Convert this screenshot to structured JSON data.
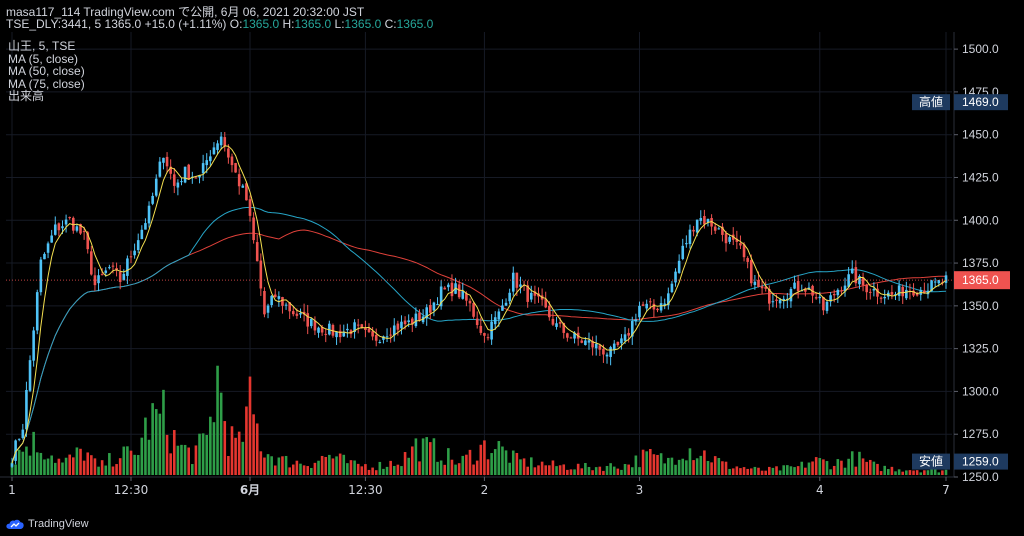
{
  "header": {
    "line1": "masa117_114 TradingView.com で公開, 6月 06, 2021 20:32:00 JST",
    "symbol": "TSE_DLY:3441, 5",
    "close": "1365.0",
    "change": "+15.0 (+1.11%)",
    "o_label": "O:",
    "o": "1365.0",
    "h_label": "H:",
    "h": "1365.0",
    "l_label": "L:",
    "l": "1365.0",
    "c_label": "C:",
    "c": "1365.0"
  },
  "legend": {
    "symbol": "山王, 5, TSE",
    "ma5": "MA (5, close)",
    "ma50": "MA (50, close)",
    "ma75": "MA (75, close)",
    "volume": "出来高"
  },
  "footer": {
    "brand": "TradingView"
  },
  "colors": {
    "up": "#26a69a",
    "up_candle": "#4fc3f7",
    "down": "#ef5350",
    "ma5": "#f5e050",
    "ma50": "#26a4c6",
    "ma75": "#e0413a",
    "vol_up": "#2e9e48",
    "vol_down": "#e5362f",
    "label_bg": "#1e3a5f",
    "price_tag": "#ef5350"
  },
  "chart_data": {
    "type": "candlestick",
    "ylim": [
      1250,
      1510
    ],
    "y_ticks": [
      "1500.0",
      "1475.0",
      "1450.0",
      "1425.0",
      "1400.0",
      "1375.0",
      "1350.0",
      "1325.0",
      "1300.0",
      "1275.0",
      "1250.0"
    ],
    "x_ticks": [
      {
        "label": "1",
        "bar": 0
      },
      {
        "label": "12:30",
        "bar": 33
      },
      {
        "label": "6月",
        "bar": 66
      },
      {
        "label": "12:30",
        "bar": 98
      },
      {
        "label": "2",
        "bar": 131
      },
      {
        "label": "3",
        "bar": 174
      },
      {
        "label": "4",
        "bar": 224
      },
      {
        "label": "7",
        "bar": 259
      }
    ],
    "high_label": "高値",
    "high_value": "1469.0",
    "high": 1469,
    "low_label": "安値",
    "low_value": "1259.0",
    "low": 1259,
    "last_price": "1365.0",
    "last": 1365,
    "anchors": [
      [
        0,
        1262
      ],
      [
        3,
        1280
      ],
      [
        8,
        1375
      ],
      [
        12,
        1395
      ],
      [
        16,
        1400
      ],
      [
        20,
        1390
      ],
      [
        23,
        1362
      ],
      [
        27,
        1372
      ],
      [
        30,
        1365
      ],
      [
        34,
        1385
      ],
      [
        38,
        1405
      ],
      [
        42,
        1440
      ],
      [
        45,
        1420
      ],
      [
        48,
        1428
      ],
      [
        52,
        1425
      ],
      [
        55,
        1440
      ],
      [
        58,
        1450
      ],
      [
        61,
        1432
      ],
      [
        65,
        1412
      ],
      [
        68,
        1375
      ],
      [
        70,
        1345
      ],
      [
        73,
        1356
      ],
      [
        77,
        1348
      ],
      [
        81,
        1342
      ],
      [
        85,
        1338
      ],
      [
        90,
        1334
      ],
      [
        95,
        1337
      ],
      [
        100,
        1330
      ],
      [
        105,
        1337
      ],
      [
        110,
        1340
      ],
      [
        115,
        1346
      ],
      [
        119,
        1358
      ],
      [
        123,
        1360
      ],
      [
        127,
        1350
      ],
      [
        131,
        1332
      ],
      [
        135,
        1345
      ],
      [
        139,
        1366
      ],
      [
        143,
        1356
      ],
      [
        147,
        1350
      ],
      [
        151,
        1338
      ],
      [
        155,
        1332
      ],
      [
        160,
        1328
      ],
      [
        166,
        1322
      ],
      [
        170,
        1330
      ],
      [
        174,
        1350
      ],
      [
        178,
        1348
      ],
      [
        182,
        1356
      ],
      [
        186,
        1383
      ],
      [
        190,
        1402
      ],
      [
        194,
        1398
      ],
      [
        198,
        1390
      ],
      [
        202,
        1382
      ],
      [
        206,
        1362
      ],
      [
        210,
        1355
      ],
      [
        215,
        1358
      ],
      [
        219,
        1362
      ],
      [
        222,
        1358
      ],
      [
        225,
        1348
      ],
      [
        229,
        1360
      ],
      [
        233,
        1368
      ],
      [
        236,
        1362
      ],
      [
        240,
        1358
      ],
      [
        244,
        1356
      ],
      [
        248,
        1360
      ],
      [
        252,
        1360
      ],
      [
        256,
        1362
      ],
      [
        259,
        1365
      ]
    ],
    "volume_anchors": [
      [
        0,
        0.15
      ],
      [
        5,
        0.35
      ],
      [
        10,
        0.25
      ],
      [
        14,
        0.12
      ],
      [
        20,
        0.25
      ],
      [
        24,
        0.08
      ],
      [
        30,
        0.22
      ],
      [
        34,
        0.2
      ],
      [
        38,
        0.55
      ],
      [
        42,
        0.6
      ],
      [
        46,
        0.3
      ],
      [
        50,
        0.22
      ],
      [
        54,
        0.35
      ],
      [
        57,
        1.0
      ],
      [
        60,
        0.4
      ],
      [
        63,
        0.3
      ],
      [
        66,
        0.7
      ],
      [
        70,
        0.25
      ],
      [
        75,
        0.15
      ],
      [
        82,
        0.12
      ],
      [
        88,
        0.2
      ],
      [
        95,
        0.1
      ],
      [
        102,
        0.1
      ],
      [
        108,
        0.15
      ],
      [
        112,
        0.3
      ],
      [
        118,
        0.25
      ],
      [
        124,
        0.12
      ],
      [
        130,
        0.28
      ],
      [
        134,
        0.3
      ],
      [
        140,
        0.15
      ],
      [
        150,
        0.1
      ],
      [
        160,
        0.08
      ],
      [
        170,
        0.1
      ],
      [
        176,
        0.2
      ],
      [
        182,
        0.15
      ],
      [
        186,
        0.3
      ],
      [
        192,
        0.22
      ],
      [
        198,
        0.1
      ],
      [
        208,
        0.05
      ],
      [
        218,
        0.08
      ],
      [
        222,
        0.15
      ],
      [
        228,
        0.12
      ],
      [
        234,
        0.18
      ],
      [
        240,
        0.08
      ],
      [
        248,
        0.06
      ],
      [
        259,
        0.05
      ]
    ],
    "series": [
      {
        "name": "MA (5, close)"
      },
      {
        "name": "MA (50, close)"
      },
      {
        "name": "MA (75, close)"
      },
      {
        "name": "出来高"
      }
    ]
  }
}
